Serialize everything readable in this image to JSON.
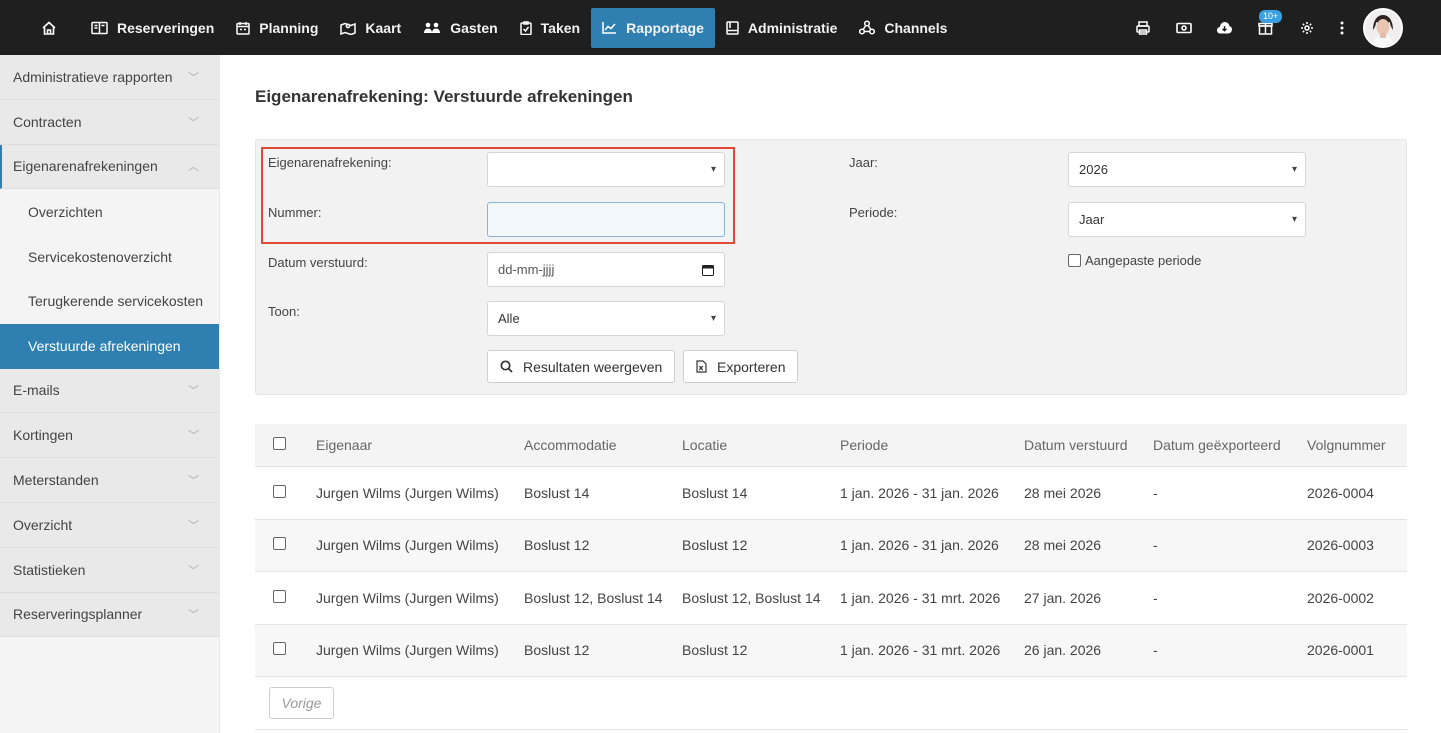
{
  "nav": {
    "items": [
      {
        "label": "Reserveringen",
        "icon": "book-icon"
      },
      {
        "label": "Planning",
        "icon": "calendar-icon"
      },
      {
        "label": "Kaart",
        "icon": "map-icon"
      },
      {
        "label": "Gasten",
        "icon": "users-icon"
      },
      {
        "label": "Taken",
        "icon": "clipboard-icon"
      },
      {
        "label": "Rapportage",
        "icon": "chart-icon",
        "active": true
      },
      {
        "label": "Administratie",
        "icon": "ledger-icon"
      },
      {
        "label": "Channels",
        "icon": "network-icon"
      }
    ],
    "badge": "10+",
    "accent": "#2f7fb0"
  },
  "sidebar": {
    "items": [
      {
        "label": "Administratieve rapporten"
      },
      {
        "label": "Contracten"
      },
      {
        "label": "Eigenarenafrekeningen",
        "open": true
      },
      {
        "label": "E-mails"
      },
      {
        "label": "Kortingen"
      },
      {
        "label": "Meterstanden"
      },
      {
        "label": "Overzicht"
      },
      {
        "label": "Statistieken"
      },
      {
        "label": "Reserveringsplanner"
      }
    ],
    "subitems": [
      {
        "label": "Overzichten"
      },
      {
        "label": "Servicekostenoverzicht"
      },
      {
        "label": "Terugkerende servicekosten"
      },
      {
        "label": "Verstuurde afrekeningen",
        "active": true
      }
    ]
  },
  "page": {
    "title": "Eigenarenafrekening: Verstuurde afrekeningen"
  },
  "filters": {
    "afrekening_label": "Eigenarenafrekening:",
    "afrekening_value": "",
    "nummer_label": "Nummer:",
    "nummer_value": "",
    "datum_label": "Datum verstuurd:",
    "datum_placeholder": "dd-mm-jjjj",
    "toon_label": "Toon:",
    "toon_value": "Alle",
    "jaar_label": "Jaar:",
    "jaar_value": "2026",
    "periode_label": "Periode:",
    "periode_value": "Jaar",
    "aangepast_label": "Aangepaste periode",
    "btn_results": "Resultaten weergeven",
    "btn_export": "Exporteren"
  },
  "table": {
    "headers": [
      "Eigenaar",
      "Accommodatie",
      "Locatie",
      "Periode",
      "Datum verstuurd",
      "Datum geëxporteerd",
      "Volgnummer"
    ],
    "rows": [
      [
        "Jurgen Wilms (Jurgen Wilms)",
        "Boslust 14",
        "Boslust 14",
        "1 jan. 2026 - 31 jan. 2026",
        "28 mei 2026",
        "-",
        "2026-0004"
      ],
      [
        "Jurgen Wilms (Jurgen Wilms)",
        "Boslust 12",
        "Boslust 12",
        "1 jan. 2026 - 31 jan. 2026",
        "28 mei 2026",
        "-",
        "2026-0003"
      ],
      [
        "Jurgen Wilms (Jurgen Wilms)",
        "Boslust 12, Boslust 14",
        "Boslust 12, Boslust 14",
        "1 jan. 2026 - 31 mrt. 2026",
        "27 jan. 2026",
        "-",
        "2026-0002"
      ],
      [
        "Jurgen Wilms (Jurgen Wilms)",
        "Boslust 12",
        "Boslust 12",
        "1 jan. 2026 - 31 mrt. 2026",
        "26 jan. 2026",
        "-",
        "2026-0001"
      ]
    ]
  },
  "pagination": {
    "prev": "Vorige"
  }
}
